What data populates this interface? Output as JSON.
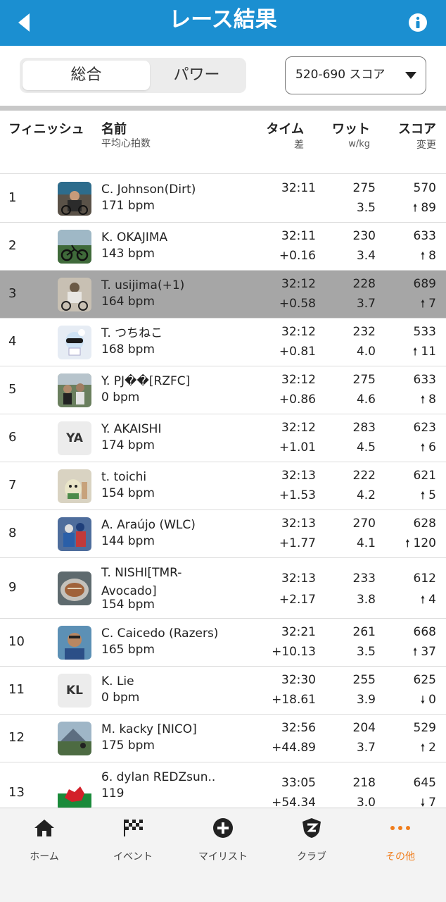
{
  "header": {
    "title": "レース結果",
    "back_icon": "chevron-left-icon",
    "info_icon": "info-icon"
  },
  "controls": {
    "tabs": [
      {
        "label": "総合",
        "active": true
      },
      {
        "label": "パワー",
        "active": false
      }
    ],
    "category_select": {
      "value": "520-690 スコア",
      "icon": "caret-down-icon"
    }
  },
  "table": {
    "columns": {
      "finish": "フィニッシュ",
      "name": "名前",
      "name_sub": "平均心拍数",
      "time": "タイム",
      "time_sub": "差",
      "watts": "ワット",
      "watts_sub": "w/kg",
      "score": "スコア",
      "score_sub": "変更"
    },
    "rows": [
      {
        "pos": "1",
        "name": "C. Johnson(Dirt)",
        "hr": "171 bpm",
        "time": "32:11",
        "gap": "",
        "watts": "275",
        "wkg": "3.5",
        "score": "570",
        "dir": "up",
        "change": "89",
        "avatar": "photo-cyclist-icon"
      },
      {
        "pos": "2",
        "name": "K. OKAJIMA",
        "hr": "143 bpm",
        "time": "32:11",
        "gap": "+0.16",
        "watts": "230",
        "wkg": "3.4",
        "score": "633",
        "dir": "up",
        "change": "8",
        "avatar": "photo-bike-icon"
      },
      {
        "pos": "3",
        "name": "T. usijima(+1)",
        "hr": "164 bpm",
        "time": "32:12",
        "gap": "+0.58",
        "watts": "228",
        "wkg": "3.7",
        "score": "689",
        "dir": "up",
        "change": "7",
        "avatar": "photo-rider-icon",
        "highlight": true
      },
      {
        "pos": "4",
        "name": "T. つちねこ",
        "hr": "168 bpm",
        "time": "32:12",
        "gap": "+0.81",
        "watts": "232",
        "wkg": "4.0",
        "score": "533",
        "dir": "up",
        "change": "11",
        "avatar": "photo-anime-icon"
      },
      {
        "pos": "5",
        "name": "Y. PJ��[RZFC]",
        "hr": "0 bpm",
        "time": "32:12",
        "gap": "+0.86",
        "watts": "275",
        "wkg": "4.6",
        "score": "633",
        "dir": "up",
        "change": "8",
        "avatar": "photo-group-icon"
      },
      {
        "pos": "6",
        "name": "Y. AKAISHI",
        "hr": "174 bpm",
        "time": "32:12",
        "gap": "+1.01",
        "watts": "283",
        "wkg": "4.5",
        "score": "623",
        "dir": "up",
        "change": "6",
        "initials": "YA"
      },
      {
        "pos": "7",
        "name": "t. toichi",
        "hr": "154 bpm",
        "time": "32:13",
        "gap": "+1.53",
        "watts": "222",
        "wkg": "4.2",
        "score": "621",
        "dir": "up",
        "change": "5",
        "avatar": "photo-figure-icon"
      },
      {
        "pos": "8",
        "name": "A. Araújo (WLC)",
        "hr": "144 bpm",
        "time": "32:13",
        "gap": "+1.77",
        "watts": "270",
        "wkg": "4.1",
        "score": "628",
        "dir": "up",
        "change": "120",
        "avatar": "photo-race-icon"
      },
      {
        "pos": "9",
        "name": "T. NISHI[TMR-Avocado]",
        "hr": "154 bpm",
        "time": "32:13",
        "gap": "+2.17",
        "watts": "233",
        "wkg": "3.8",
        "score": "612",
        "dir": "up",
        "change": "4",
        "avatar": "photo-food-icon"
      },
      {
        "pos": "10",
        "name": "C. Caicedo (Razers)",
        "hr": "165 bpm",
        "time": "32:21",
        "gap": "+10.13",
        "watts": "261",
        "wkg": "3.5",
        "score": "668",
        "dir": "up",
        "change": "37",
        "avatar": "photo-portrait-icon"
      },
      {
        "pos": "11",
        "name": "K. Lie",
        "hr": "0 bpm",
        "time": "32:30",
        "gap": "+18.61",
        "watts": "255",
        "wkg": "3.9",
        "score": "625",
        "dir": "down",
        "change": "0",
        "initials": "KL"
      },
      {
        "pos": "12",
        "name": "M. kacky [NICO]",
        "hr": "175 bpm",
        "time": "32:56",
        "gap": "+44.89",
        "watts": "204",
        "wkg": "3.7",
        "score": "529",
        "dir": "up",
        "change": "2",
        "avatar": "photo-landscape-icon"
      },
      {
        "pos": "13",
        "name": "6. dylan REDZsun..",
        "hr": "119",
        "time": "33:05",
        "gap": "+54.34",
        "watts": "218",
        "wkg": "3.0",
        "score": "645",
        "dir": "down",
        "change": "7",
        "avatar": "welsh-flag-icon"
      }
    ]
  },
  "nav": {
    "items": [
      {
        "label": "ホーム",
        "icon": "home-icon"
      },
      {
        "label": "イベント",
        "icon": "checkered-flag-icon"
      },
      {
        "label": "マイリスト",
        "icon": "plus-circle-icon"
      },
      {
        "label": "クラブ",
        "icon": "zwift-shield-icon"
      },
      {
        "label": "その他",
        "icon": "more-dots-icon",
        "active": true
      }
    ]
  },
  "colors": {
    "primary": "#1b8fd1",
    "highlight_row": "#a6a6a6",
    "accent_orange": "#f07d1c"
  }
}
